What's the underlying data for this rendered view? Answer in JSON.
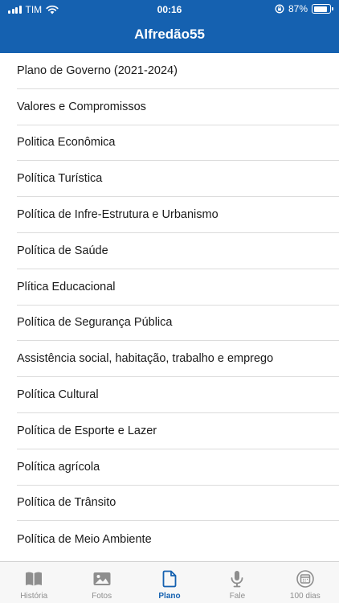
{
  "status_bar": {
    "carrier": "TIM",
    "time": "00:16",
    "battery": "87%",
    "battery_level": 0.87
  },
  "header": {
    "title": "Alfredão55"
  },
  "list": {
    "items": [
      "Plano de Governo (2021-2024)",
      "Valores e Compromissos",
      "Politica Econômica",
      "Política Turística",
      "Política de Infre-Estrutura e Urbanismo",
      "Política de Saúde",
      "Plítica Educacional",
      "Política de Segurança Pública",
      "Assistência social, habitação, trabalho e emprego",
      "Política Cultural",
      "Política de Esporte e Lazer",
      "Política agrícola",
      "Política de Trânsito",
      "Política de Meio Ambiente"
    ]
  },
  "tabbar": {
    "accent": "#1561b0",
    "inactive_color": "#8e8e8e",
    "active_index": 2,
    "tabs": [
      {
        "label": "História",
        "icon": "book-icon"
      },
      {
        "label": "Fotos",
        "icon": "photo-icon"
      },
      {
        "label": "Plano",
        "icon": "document-icon"
      },
      {
        "label": "Fale",
        "icon": "microphone-icon"
      },
      {
        "label": "100 dias",
        "icon": "calendar-icon"
      }
    ]
  }
}
